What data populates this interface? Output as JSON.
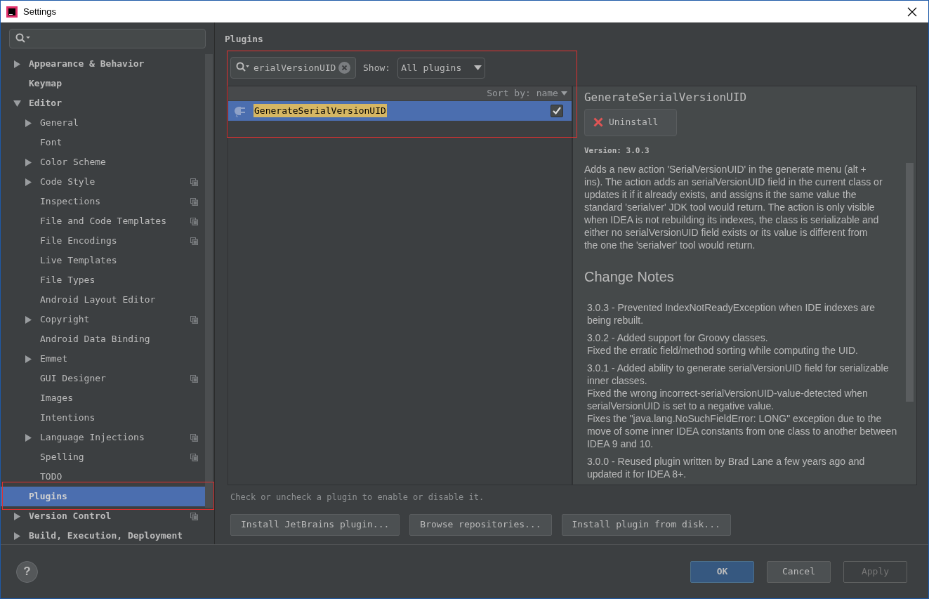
{
  "window": {
    "title": "Settings"
  },
  "sidebar": {
    "items": [
      {
        "label": "Appearance & Behavior",
        "expanded": false,
        "has_children": true,
        "selected": false,
        "highlighted": false,
        "project_icon": false
      },
      {
        "label": "Keymap",
        "has_children": false,
        "selected": false,
        "highlighted": false,
        "project_icon": false
      },
      {
        "label": "Editor",
        "expanded": true,
        "has_children": true,
        "selected": false,
        "highlighted": false,
        "project_icon": false,
        "children": [
          {
            "label": "General",
            "expanded": false,
            "has_children": true,
            "selected": false,
            "project_icon": false
          },
          {
            "label": "Font",
            "has_children": false,
            "selected": false,
            "project_icon": false
          },
          {
            "label": "Color Scheme",
            "expanded": false,
            "has_children": true,
            "selected": false,
            "project_icon": false
          },
          {
            "label": "Code Style",
            "expanded": false,
            "has_children": true,
            "selected": false,
            "project_icon": true
          },
          {
            "label": "Inspections",
            "has_children": false,
            "selected": false,
            "project_icon": true
          },
          {
            "label": "File and Code Templates",
            "has_children": false,
            "selected": false,
            "project_icon": true
          },
          {
            "label": "File Encodings",
            "has_children": false,
            "selected": false,
            "project_icon": true
          },
          {
            "label": "Live Templates",
            "has_children": false,
            "selected": false,
            "project_icon": false
          },
          {
            "label": "File Types",
            "has_children": false,
            "selected": false,
            "project_icon": false
          },
          {
            "label": "Android Layout Editor",
            "has_children": false,
            "selected": false,
            "project_icon": false
          },
          {
            "label": "Copyright",
            "expanded": false,
            "has_children": true,
            "selected": false,
            "project_icon": true
          },
          {
            "label": "Android Data Binding",
            "has_children": false,
            "selected": false,
            "project_icon": false
          },
          {
            "label": "Emmet",
            "expanded": false,
            "has_children": true,
            "selected": false,
            "project_icon": false
          },
          {
            "label": "GUI Designer",
            "has_children": false,
            "selected": false,
            "project_icon": true
          },
          {
            "label": "Images",
            "has_children": false,
            "selected": false,
            "project_icon": false
          },
          {
            "label": "Intentions",
            "has_children": false,
            "selected": false,
            "project_icon": false
          },
          {
            "label": "Language Injections",
            "expanded": false,
            "has_children": true,
            "selected": false,
            "project_icon": true
          },
          {
            "label": "Spelling",
            "has_children": false,
            "selected": false,
            "project_icon": true
          },
          {
            "label": "TODO",
            "has_children": false,
            "selected": false,
            "project_icon": false
          }
        ]
      },
      {
        "label": "Plugins",
        "has_children": false,
        "selected": true,
        "highlighted": true,
        "project_icon": false
      },
      {
        "label": "Version Control",
        "expanded": false,
        "has_children": true,
        "selected": false,
        "highlighted": false,
        "project_icon": true
      },
      {
        "label": "Build, Execution, Deployment",
        "expanded": false,
        "has_children": true,
        "selected": false,
        "highlighted": false,
        "project_icon": false
      }
    ]
  },
  "main": {
    "title": "Plugins",
    "toolbar_highlighted": true,
    "search": {
      "value": "erialVersionUID"
    },
    "show_label": "Show:",
    "show_dropdown": {
      "value": "All plugins"
    },
    "sort_label": "Sort by: name",
    "plugins": [
      {
        "name": "GenerateSerialVersionUID",
        "selected": true,
        "checked": true
      }
    ],
    "detail": {
      "title": "GenerateSerialVersionUID",
      "uninstall_button": "Uninstall",
      "version": "Version: 3.0.3",
      "description": "Adds a new action 'SerialVersionUID' in the generate menu (alt + ins). The action adds an serialVersionUID field in the current class or updates it if it already exists, and assigns it the same value the standard 'serialver' JDK tool would return. The action is only visible when IDEA is not rebuilding its indexes, the class is serializable and either no serialVersionUID field exists or its value is different from the one the 'serialver' tool would return.",
      "change_notes_title": "Change Notes",
      "change_notes": [
        [
          "3.0.3 - Prevented IndexNotReadyException when IDE indexes are being rebuilt."
        ],
        [
          "3.0.2 - Added support for Groovy classes.",
          "Fixed the erratic field/method sorting while computing the UID."
        ],
        [
          "3.0.1 - Added ability to generate serialVersionUID field for serializable inner classes.",
          "Fixed the wrong incorrect-serialVersionUID-value-detected when serialVersionUID is set to a negative value.",
          "Fixes the \"java.lang.NoSuchFieldError: LONG\" exception due to the move of some inner IDEA constants from one class to another between IDEA 9 and 10."
        ],
        [
          "3.0.0 - Reused plugin written by Brad Lane a few years ago and updated it for IDEA 8+."
        ]
      ]
    },
    "hint": "Check or uncheck a plugin to enable or disable it.",
    "buttons": [
      "Install JetBrains plugin...",
      "Browse repositories...",
      "Install plugin from disk..."
    ]
  },
  "footer": {
    "help_button": "?",
    "buttons": [
      {
        "label": "OK",
        "kind": "primary",
        "disabled": false
      },
      {
        "label": "Cancel",
        "kind": "normal",
        "disabled": false
      },
      {
        "label": "Apply",
        "kind": "normal",
        "disabled": true
      }
    ]
  }
}
